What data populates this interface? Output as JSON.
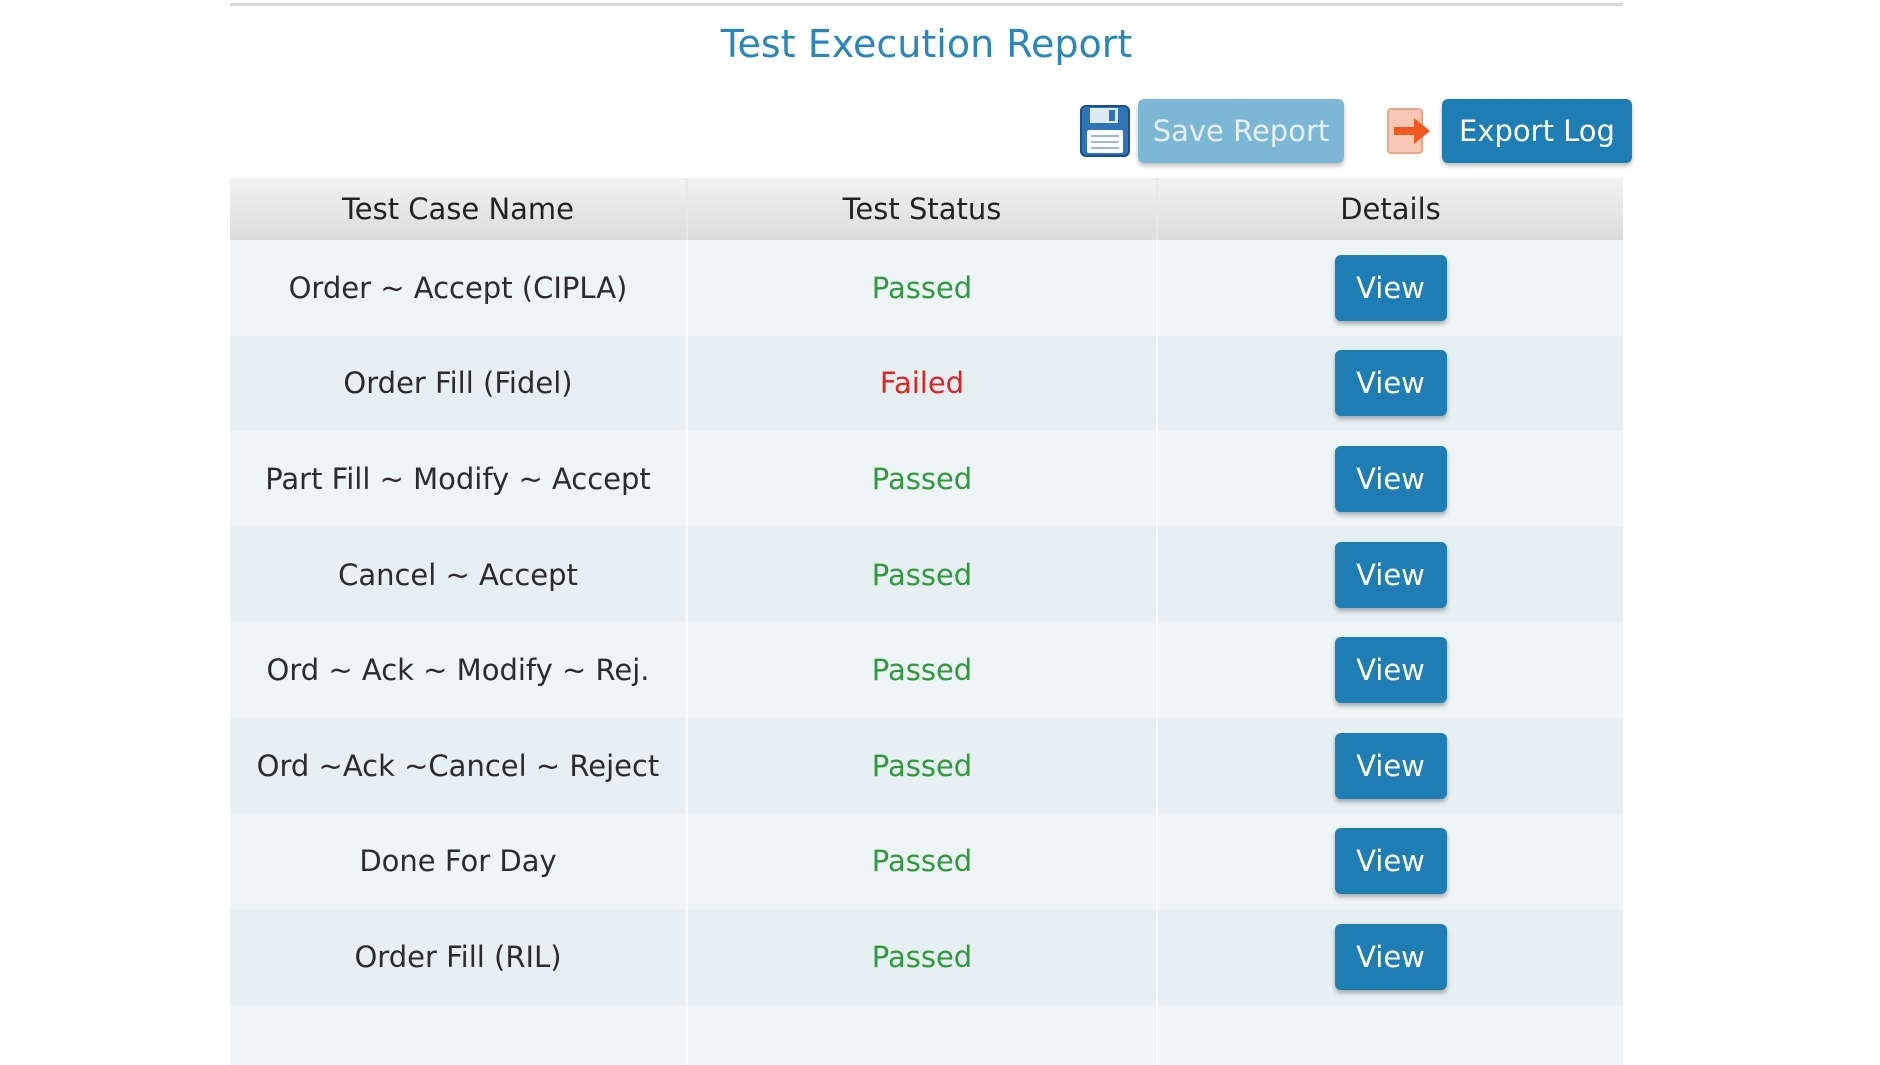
{
  "title": "Test Execution Report",
  "toolbar": {
    "save_label": "Save Report",
    "export_label": "Export Log",
    "save_icon": "floppy-disk-icon",
    "export_icon": "export-arrow-icon"
  },
  "table": {
    "headers": {
      "name": "Test Case Name",
      "status": "Test Status",
      "details": "Details"
    },
    "view_label": "View",
    "rows": [
      {
        "name": "Order ~ Accept (CIPLA)",
        "status": "Passed"
      },
      {
        "name": "Order Fill (Fidel)",
        "status": "Failed"
      },
      {
        "name": "Part Fill ~ Modify ~ Accept",
        "status": "Passed"
      },
      {
        "name": "Cancel ~ Accept",
        "status": "Passed"
      },
      {
        "name": "Ord ~ Ack ~ Modify ~ Rej.",
        "status": "Passed"
      },
      {
        "name": "Ord ~Ack ~Cancel ~ Reject",
        "status": "Passed"
      },
      {
        "name": "Done For Day",
        "status": "Passed"
      },
      {
        "name": "Order Fill (RIL)",
        "status": "Passed"
      }
    ]
  },
  "colors": {
    "title": "#2a86b8",
    "button": "#1e7db2",
    "button_disabled": "#7cb7d4",
    "passed": "#2e9a3c",
    "failed": "#e02424"
  }
}
